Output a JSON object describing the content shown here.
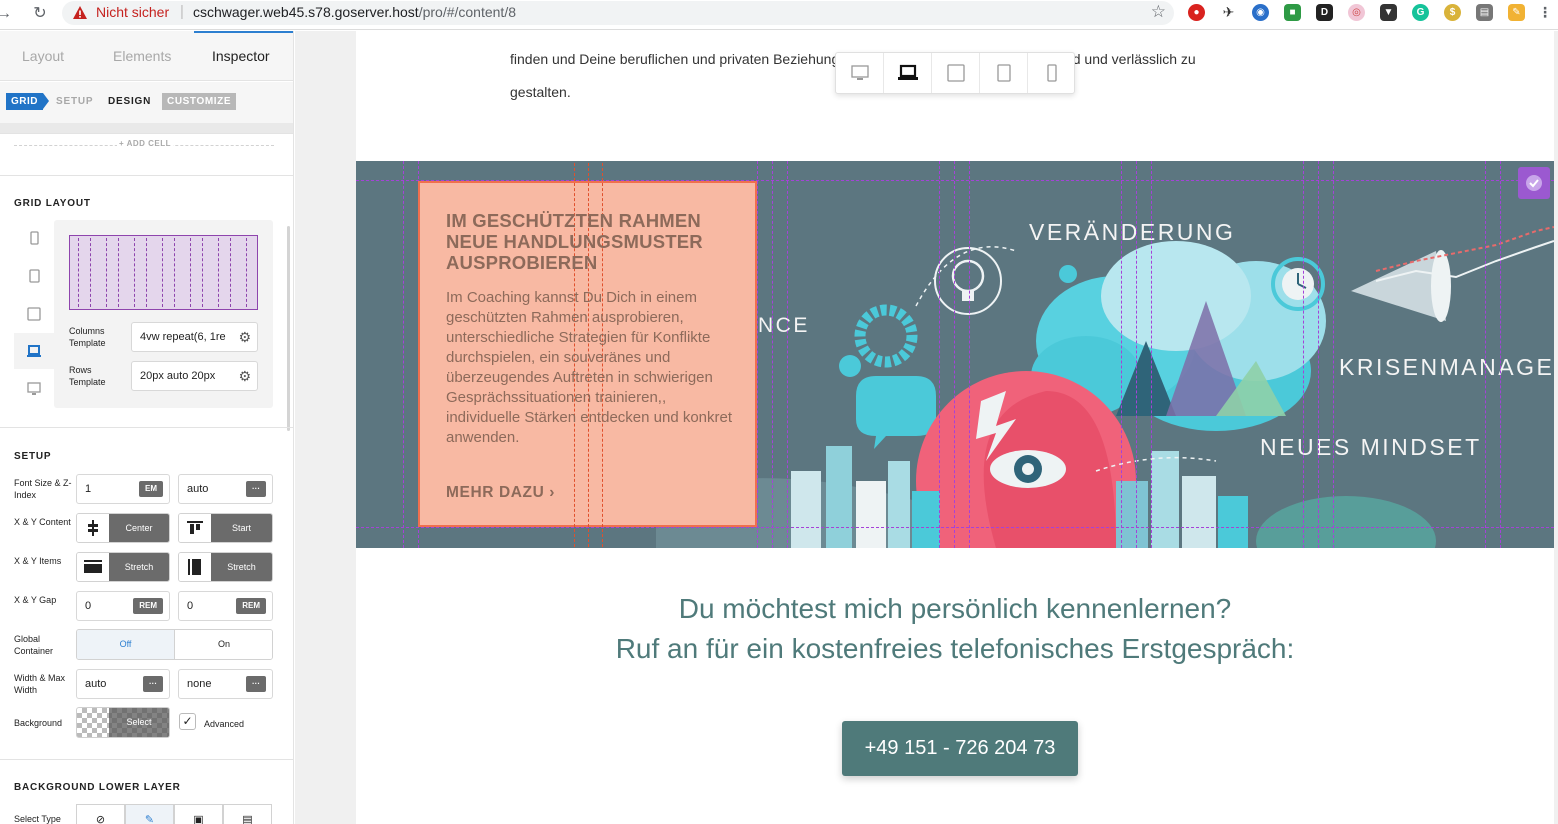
{
  "browser": {
    "not_secure": "Nicht sicher",
    "url_host": "cschwager.web45.s78.goserver.host",
    "url_path": "/pro/#/content/8"
  },
  "panel": {
    "tabs": [
      "Layout",
      "Elements",
      "Inspector"
    ],
    "active_tab": "Inspector",
    "subtabs": {
      "grid": "GRID",
      "setup": "SETUP",
      "design": "DESIGN",
      "customize": "CUSTOMIZE"
    },
    "add_cell": "+ ADD CELL",
    "grid_layout": {
      "title": "GRID LAYOUT",
      "columns_label": "Columns Template",
      "columns_value": "4vw repeat(6, 1re",
      "rows_label": "Rows Template",
      "rows_value": "20px auto 20px"
    },
    "setup": {
      "title": "SETUP",
      "font_size_label": "Font Size & Z-Index",
      "font_size_value": "1",
      "font_size_unit": "EM",
      "z_index_value": "auto",
      "more": "···",
      "xy_content_label": "X & Y Content",
      "x_content": "Center",
      "y_content": "Start",
      "xy_items_label": "X & Y Items",
      "x_items": "Stretch",
      "y_items": "Stretch",
      "xy_gap_label": "X & Y Gap",
      "x_gap": "0",
      "y_gap": "0",
      "gap_unit": "REM",
      "global_container_label": "Global Container",
      "off": "Off",
      "on": "On",
      "width_label": "Width & Max Width",
      "width_value": "auto",
      "max_width_value": "none",
      "background_label": "Background",
      "background_select": "Select",
      "advanced": "Advanced"
    },
    "bg_lower": {
      "title": "BACKGROUND LOWER LAYER",
      "select_type": "Select Type"
    }
  },
  "page": {
    "intro_text": "finden und Deine beruflichen und privaten Beziehungen tragfähig, authentisch, akzeptierend und verlässlich zu gestalten.",
    "card": {
      "title": "IM GESCHÜTZTEN RAHMEN NEUE HANDLUNGSMUSTER AUSPROBIEREN",
      "body": "Im Coaching kannst Du Dich in einem geschützten Rahmen ausprobieren, unterschiedliche Strategien für Konflikte durchspielen, ein souveränes und überzeugendes Auftreten in schwierigen Gesprächssituationen trainieren,, individuelle Stärken entdecken und konkret anwenden.",
      "link": "MEHR DAZU ›"
    },
    "hero_words": {
      "veraenderung": "VERÄNDERUNG",
      "nce": "NCE",
      "krisen": "KRISENMANAGE",
      "mindset": "NEUES MINDSET"
    },
    "cta_line1": "Du möchtest mich persönlich kennenlernen?",
    "cta_line2": "Ruf an für ein kostenfreies telefonisches Erstgespräch:",
    "phone": "+49 151 - 726 204 73"
  },
  "colors": {
    "accent_blue": "#2174c7",
    "hero_bg": "#5c7680",
    "card_bg": "#f8b9a3",
    "card_text": "#8d6a5a",
    "cta_teal": "#4f7a7a",
    "grid_lines": "#a542d8"
  }
}
